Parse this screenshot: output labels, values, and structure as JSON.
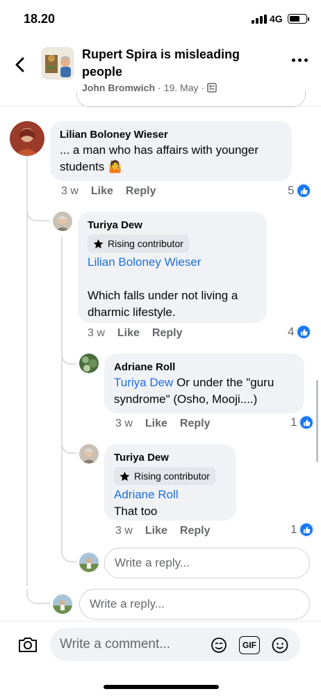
{
  "status": {
    "time": "18.20",
    "network": "4G"
  },
  "header": {
    "title": "Rupert Spira is misleading people",
    "author": "John Bromwich",
    "separator": "·",
    "date": "19. May",
    "separator2": "·"
  },
  "comments": [
    {
      "author": "Lilian Boloney Wieser",
      "text_line1": "... a man who has affairs with younger",
      "text_line2": "students",
      "emoji": "🤷",
      "time": "3 w",
      "like_label": "Like",
      "reply_label": "Reply",
      "reaction_count": "5"
    },
    {
      "author": "Turiya Dew",
      "badge": "Rising contributor",
      "mention": "Lilian Boloney Wieser",
      "text_line1": "Which falls under not living a",
      "text_line2": "dharmic lifestyle.",
      "time": "3 w",
      "like_label": "Like",
      "reply_label": "Reply",
      "reaction_count": "4"
    },
    {
      "author": "Adriane Roll",
      "mention": "Turiya Dew",
      "text_line1": " Or under the \"guru",
      "text_line2": "syndrome\" (Osho, Mooji....)",
      "time": "3 w",
      "like_label": "Like",
      "reply_label": "Reply",
      "reaction_count": "1"
    },
    {
      "author": "Turiya Dew",
      "badge": "Rising contributor",
      "mention": "Adriane Roll",
      "text_line1": "That too",
      "time": "3 w",
      "like_label": "Like",
      "reply_label": "Reply",
      "reaction_count": "1"
    }
  ],
  "reply_placeholder": "Write a reply...",
  "comment_placeholder": "Write a comment...",
  "gif_label": "GIF",
  "colors": {
    "link": "#216fdb",
    "like": "#1877f2",
    "bubble": "#f0f2f5",
    "meta": "#65676b"
  },
  "icons": [
    "back-arrow-icon",
    "more-icon",
    "page-icon",
    "like-icon",
    "star-icon",
    "camera-icon",
    "avatar-sticker-icon",
    "gif-icon",
    "smiley-icon"
  ]
}
